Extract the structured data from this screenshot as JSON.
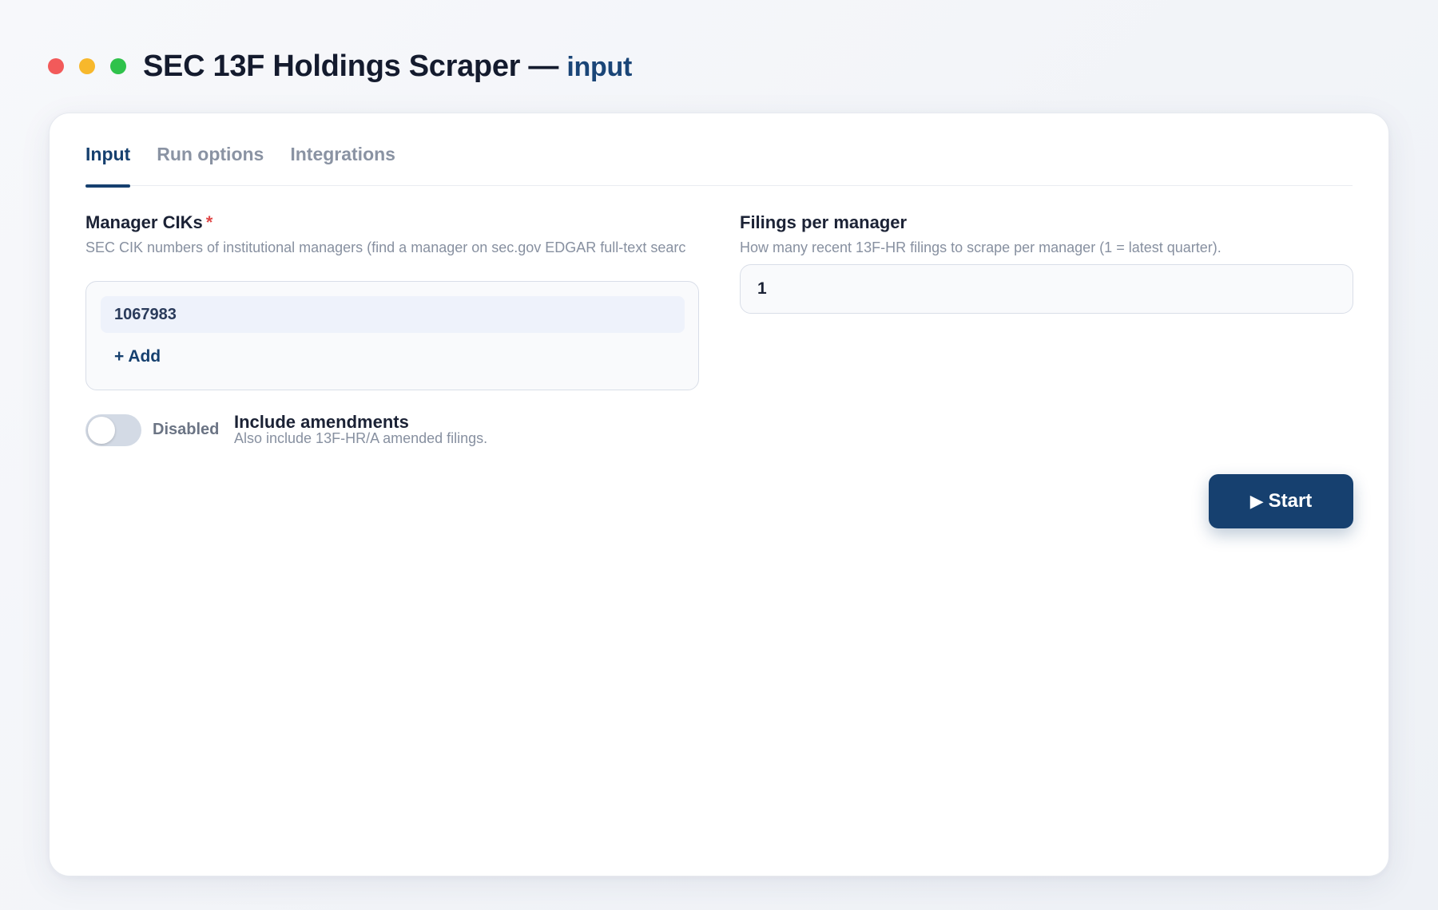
{
  "window": {
    "title": "SEC 13F Holdings Scraper —",
    "subtitle": "input"
  },
  "tabs": [
    {
      "label": "Input",
      "active": true
    },
    {
      "label": "Run options",
      "active": false
    },
    {
      "label": "Integrations",
      "active": false
    }
  ],
  "manager_ciks": {
    "label": "Manager CIKs",
    "required_mark": "*",
    "help": "SEC CIK numbers of institutional managers (find a manager on sec.gov EDGAR full-text searc",
    "items": [
      "1067983"
    ],
    "add_label": "+ Add"
  },
  "filings_per_manager": {
    "label": "Filings per manager",
    "help": "How many recent 13F-HR filings to scrape per manager (1 = latest quarter).",
    "value": "1"
  },
  "include_amendments": {
    "state_label": "Disabled",
    "enabled": false,
    "title": "Include amendments",
    "description": "Also include 13F-HR/A amended filings."
  },
  "actions": {
    "start_icon": "▶",
    "start_label": "Start"
  },
  "colors": {
    "accent": "#16406f",
    "required": "#e04848",
    "traffic_red": "#f25a5a",
    "traffic_yellow": "#f7b82c",
    "traffic_green": "#2fc24b"
  }
}
